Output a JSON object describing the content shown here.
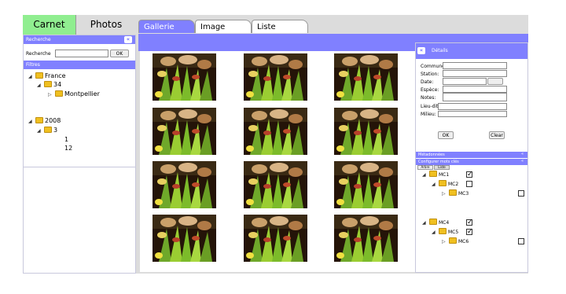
{
  "tabs": {
    "carnet": "Carnet",
    "photos": "Photos"
  },
  "left": {
    "search_header": "Recherche",
    "collapse": "«",
    "search_label": "Recherche",
    "ok": "OK",
    "filters_header": "Filtres",
    "tree": {
      "france": "France",
      "n34": "34",
      "montpellier": "Montpellier",
      "y2008": "2008",
      "m3": "3",
      "d1": "1",
      "d12": "12"
    }
  },
  "main_tabs": {
    "gallerie": "Gallerie",
    "image": "Image",
    "liste": "Liste"
  },
  "details": {
    "collapse": "«",
    "title": "Détails",
    "commune": "Commune:",
    "station": "Station:",
    "date": "Date:",
    "espece": "Espèce:",
    "notes": "Notes:",
    "lieudit": "Lieu-dit:",
    "milieu": "Milieu:",
    "ok": "OK",
    "clear": "Clear"
  },
  "meta": {
    "metadonnees": "Métadonnées",
    "configurer": "Configurer mots clés",
    "toggle": "«",
    "tab_arbre": "Arbre",
    "tab_liste": "Liste",
    "check": "✓",
    "mc1": "MC1",
    "mc2": "MC2",
    "mc3": "MC3",
    "mc4": "MC4",
    "mc5": "MC5",
    "mc6": "MC6"
  },
  "gallery_count": 12
}
